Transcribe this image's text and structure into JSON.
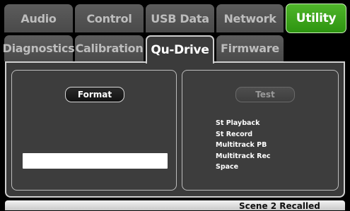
{
  "tabs_row1": [
    "Audio",
    "Control",
    "USB Data",
    "Network",
    "Utility"
  ],
  "tabs_row2": [
    "Diagnostics",
    "Calibration",
    "Qu-Drive",
    "Firmware"
  ],
  "format_panel": {
    "button_label": "Format"
  },
  "test_panel": {
    "button_label": "Test",
    "items": [
      "St Playback",
      "St Record",
      "Multitrack PB",
      "Multitrack Rec",
      "Space"
    ]
  },
  "status": "Scene 2 Recalled",
  "colors": {
    "active_category": "#3da11c",
    "panel_bg": "#3b3b3b",
    "tab_bg": "#545454"
  }
}
